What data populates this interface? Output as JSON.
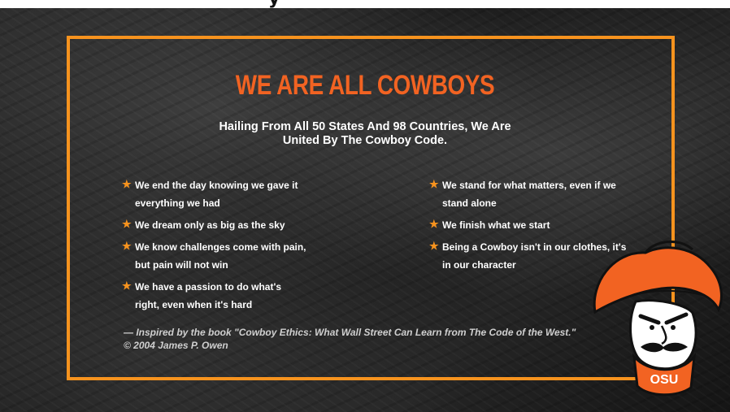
{
  "top_heading_fragment": "y",
  "hero": {
    "title": "WE ARE ALL COWBOYS",
    "subtitle": "Hailing From All 50 States And 98 Countries, We Are United By The Cowboy Code.",
    "left_items": [
      "We end the day knowing we gave it everything we had",
      "We dream only as big as the sky",
      "We know challenges come with pain, but pain will not win",
      "We have a passion to do what's right, even when it's hard"
    ],
    "right_items": [
      "We stand for what matters, even if we stand alone",
      "We finish what we start",
      "Being a Cowboy isn't in our clothes, it's in our character"
    ],
    "citation": "— Inspired by the book \"Cowboy Ethics: What Wall Street Can Learn from The Code of the West.\" © 2004 James P. Owen",
    "mascot_badge": "OSU"
  },
  "icons": {
    "bullet": "star-icon"
  },
  "colors": {
    "title": "#f26322",
    "frame": "#f7931e",
    "star": "#f7931e",
    "text": "#ffffff",
    "background": "#1e1e1e"
  }
}
